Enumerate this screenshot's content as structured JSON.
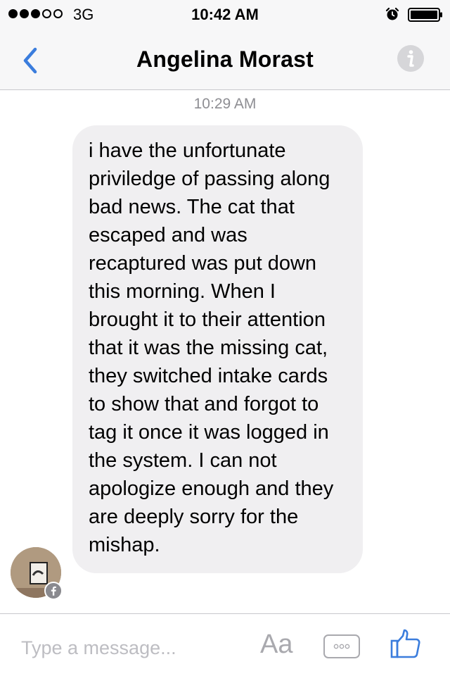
{
  "status_bar": {
    "carrier": "3G",
    "time": "10:42 AM",
    "signal_bars_filled": 3,
    "signal_bars_total": 5,
    "icons": [
      "alarm-icon",
      "battery-icon"
    ]
  },
  "nav": {
    "contact_name": "Angelina Morast",
    "icons": [
      "back-chevron-icon",
      "info-icon"
    ]
  },
  "conversation": {
    "timestamp": "10:29 AM",
    "messages": [
      {
        "sender": "incoming",
        "text": "i have the unfortunate priviledge of passing along bad news. The cat that escaped and was recaptured was put down this morning. When I brought it to their attention that it was the missing cat, they switched intake cards to show that and forgot to tag it once it was logged in the system. I can not apologize enough and they are deeply sorry for the mishap."
      }
    ]
  },
  "composer": {
    "placeholder": "Type a message...",
    "value": "",
    "aa_label": "Aa",
    "icons": [
      "more-options-icon",
      "thumbs-up-icon"
    ]
  },
  "colors": {
    "accent": "#3b7ddd",
    "bubble_background": "#f0eff1",
    "bar_background": "#f7f7f8",
    "muted_text": "#8e8e93"
  }
}
